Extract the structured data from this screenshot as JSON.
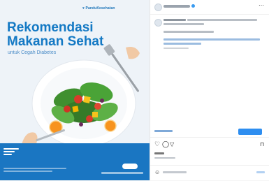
{
  "post_image": {
    "brand": "♥ PanduKesehatan",
    "headline_line1": "Rekomendasi",
    "headline_line2": "Makanan Sehat",
    "subheadline": "untuk Cegah Diabetes"
  },
  "colors": {
    "brand_blue": "#1479c4",
    "footer_blue": "#1a76c2",
    "accent_button": "#2e8ef0"
  },
  "icons": {
    "like": "heart-outline",
    "comment": "speech-bubble",
    "share": "paper-plane",
    "save": "bookmark",
    "more": "ellipsis",
    "emoji": "smiley"
  }
}
